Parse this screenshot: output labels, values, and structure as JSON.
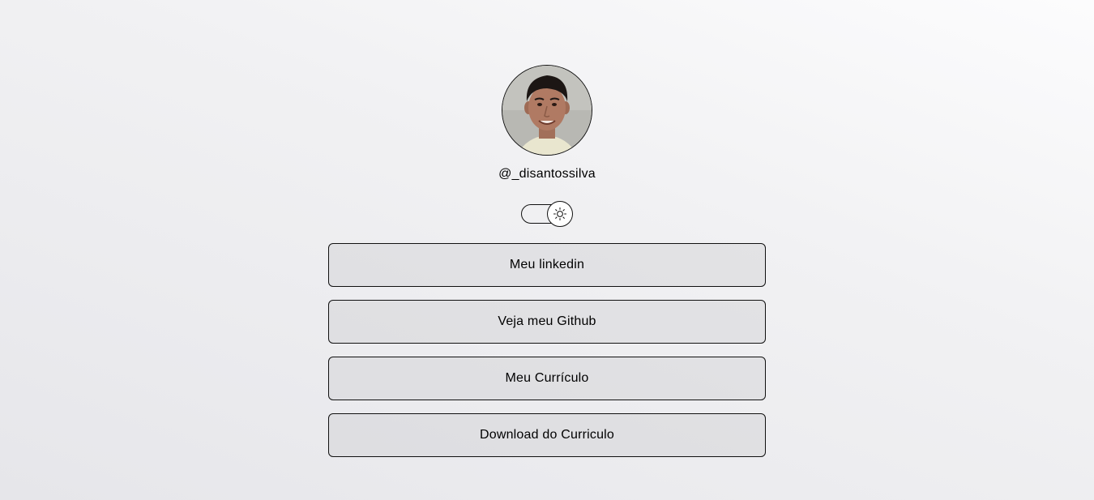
{
  "profile": {
    "username": "@_disantossilva",
    "avatar_icon": "profile-photo"
  },
  "theme_toggle": {
    "icon": "sun-icon",
    "state": "light"
  },
  "links": [
    {
      "label": "Meu linkedin"
    },
    {
      "label": "Veja meu Github"
    },
    {
      "label": "Meu Currículo"
    },
    {
      "label": "Download do Curriculo"
    }
  ],
  "colors": {
    "border": "#111111",
    "text": "#000000",
    "background_light": "#fcfcfd",
    "background_dark": "#e6e6ea"
  }
}
